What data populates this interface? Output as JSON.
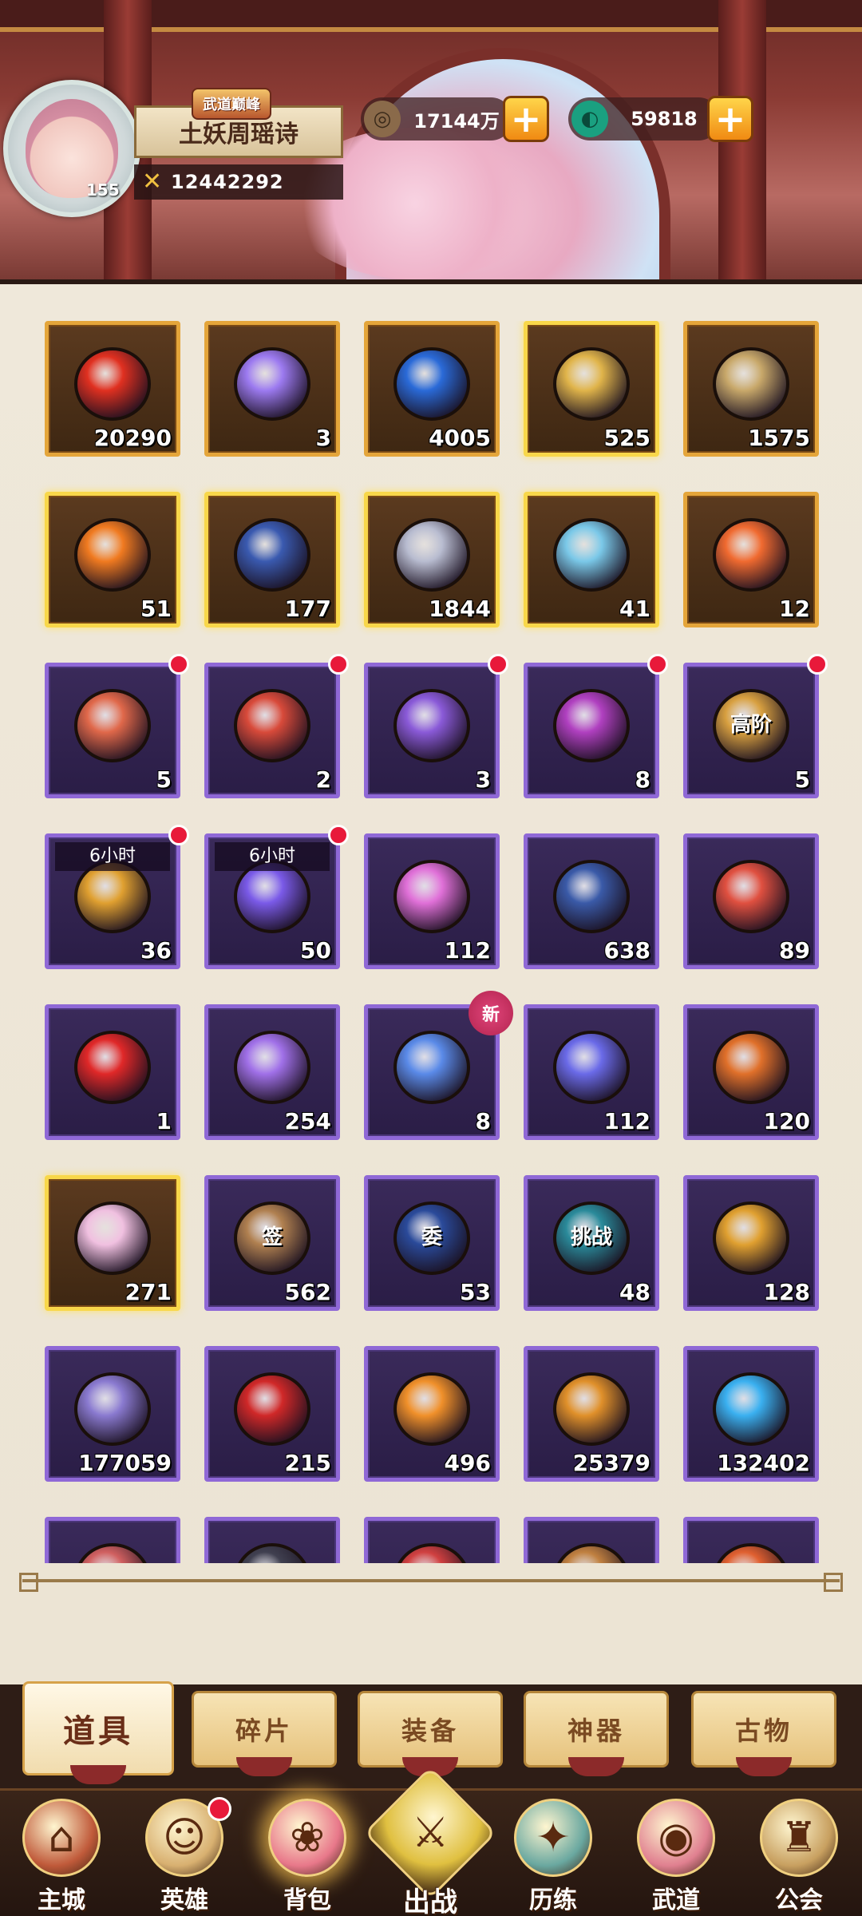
{
  "player": {
    "title_badge": "武道巅峰",
    "name": "土妖周瑶诗",
    "level": "155",
    "power": "12442292"
  },
  "resources": {
    "copper": "17144万",
    "jade": "59818"
  },
  "items": [
    {
      "qty": "20290",
      "frame": "gold",
      "icon": "red-orb-icon",
      "color": "#e03020"
    },
    {
      "qty": "3",
      "frame": "gold",
      "icon": "rainbow-crystal-icon",
      "color": "#9c7af0"
    },
    {
      "qty": "4005",
      "frame": "gold",
      "icon": "blue-powder-icon",
      "color": "#2a6ad8"
    },
    {
      "qty": "525",
      "frame": "gold glow",
      "icon": "gold-coin-icon",
      "color": "#e0b44a"
    },
    {
      "qty": "1575",
      "frame": "gold",
      "icon": "dagger-icon",
      "color": "#c8a86a"
    },
    {
      "qty": "51",
      "frame": "gold glow",
      "icon": "orange-swirl-icon",
      "color": "#f07a20"
    },
    {
      "qty": "177",
      "frame": "gold glow",
      "icon": "bagua-icon",
      "color": "#3a5ab0"
    },
    {
      "qty": "1844",
      "frame": "gold glow",
      "icon": "stone-block-icon",
      "color": "#b8bcd0"
    },
    {
      "qty": "41",
      "frame": "gold glow",
      "icon": "water-bottle-icon",
      "color": "#7ac8e8"
    },
    {
      "qty": "12",
      "frame": "gold",
      "icon": "fire-swirl-icon",
      "color": "#f06a30"
    },
    {
      "qty": "5",
      "frame": "purple",
      "icon": "treasure-chest-icon",
      "color": "#e0684a",
      "dot": true
    },
    {
      "qty": "2",
      "frame": "purple",
      "icon": "treasure-chest-icon",
      "color": "#d84a3a",
      "dot": true
    },
    {
      "qty": "3",
      "frame": "purple",
      "icon": "purple-chest-icon",
      "color": "#8a5ad8",
      "dot": true
    },
    {
      "qty": "8",
      "frame": "purple",
      "icon": "purple-box-icon",
      "color": "#b040c0",
      "dot": true
    },
    {
      "qty": "5",
      "frame": "purple",
      "icon": "gold-chest-icon",
      "color": "#d8a040",
      "dot": true,
      "label": "高阶"
    },
    {
      "qty": "36",
      "frame": "purple",
      "icon": "coin-bag-icon",
      "color": "#e0a030",
      "dot": true,
      "timer": "6小时"
    },
    {
      "qty": "50",
      "frame": "purple",
      "icon": "spirit-bag-icon",
      "color": "#7a5ae8",
      "dot": true,
      "timer": "6小时"
    },
    {
      "qty": "112",
      "frame": "purple",
      "icon": "pink-gem-icon",
      "color": "#e070d8"
    },
    {
      "qty": "638",
      "frame": "purple",
      "icon": "go-stones-icon",
      "color": "#3a5aa8"
    },
    {
      "qty": "89",
      "frame": "purple",
      "icon": "scroll-icon",
      "color": "#e05040"
    },
    {
      "qty": "1",
      "frame": "purple",
      "icon": "target-icon",
      "color": "#e02828"
    },
    {
      "qty": "254",
      "frame": "purple",
      "icon": "purple-medal-icon",
      "color": "#a070e8"
    },
    {
      "qty": "8",
      "frame": "purple",
      "icon": "blue-gem-icon",
      "color": "#5a8ae8",
      "new": "新"
    },
    {
      "qty": "112",
      "frame": "purple",
      "icon": "spirit-orb-icon",
      "color": "#6a6ae8"
    },
    {
      "qty": "120",
      "frame": "purple",
      "icon": "orange-disc-icon",
      "color": "#e0702a"
    },
    {
      "qty": "271",
      "frame": "gold glow",
      "icon": "rainbow-star-icon",
      "color": "#f0c0e0"
    },
    {
      "qty": "562",
      "frame": "purple",
      "icon": "sign-ticket-icon",
      "color": "#b08050",
      "label": "签"
    },
    {
      "qty": "53",
      "frame": "purple",
      "icon": "delegate-ticket-icon",
      "color": "#2a4a9a",
      "label": "委"
    },
    {
      "qty": "48",
      "frame": "purple",
      "icon": "challenge-ticket-icon",
      "color": "#2a8a9a",
      "label": "挑战"
    },
    {
      "qty": "128",
      "frame": "purple",
      "icon": "lion-token-icon",
      "color": "#e0a030"
    },
    {
      "qty": "177059",
      "frame": "purple",
      "icon": "soul-crystal-icon",
      "color": "#8a7ad0"
    },
    {
      "qty": "215",
      "frame": "purple",
      "icon": "red-swirl-icon",
      "color": "#d02828"
    },
    {
      "qty": "496",
      "frame": "purple",
      "icon": "flame-paw-icon",
      "color": "#f0902a"
    },
    {
      "qty": "25379",
      "frame": "purple",
      "icon": "paw-gem-icon",
      "color": "#e0902a"
    },
    {
      "qty": "132402",
      "frame": "purple",
      "icon": "ice-crystal-icon",
      "color": "#3ab0f0"
    },
    {
      "qty": "",
      "frame": "purple",
      "icon": "partial-item-icon",
      "color": "#d06060"
    },
    {
      "qty": "",
      "frame": "purple",
      "icon": "partial-item-icon",
      "color": "#404050"
    },
    {
      "qty": "",
      "frame": "purple",
      "icon": "partial-item-icon",
      "color": "#d04040"
    },
    {
      "qty": "",
      "frame": "purple",
      "icon": "partial-item-icon",
      "color": "#c08040"
    },
    {
      "qty": "",
      "frame": "purple",
      "icon": "partial-item-icon",
      "color": "#e06030"
    }
  ],
  "tabs": [
    {
      "label": "道具",
      "active": true
    },
    {
      "label": "碎片"
    },
    {
      "label": "装备"
    },
    {
      "label": "神器"
    },
    {
      "label": "古物"
    }
  ],
  "nav": [
    {
      "label": "主城",
      "icon": "castle-icon"
    },
    {
      "label": "英雄",
      "icon": "hero-icon",
      "dot": true
    },
    {
      "label": "背包",
      "icon": "bag-icon",
      "active": true
    },
    {
      "label": "出战",
      "icon": "battle-icon",
      "big": true
    },
    {
      "label": "历练",
      "icon": "training-icon"
    },
    {
      "label": "武道",
      "icon": "martial-icon"
    },
    {
      "label": "公会",
      "icon": "guild-icon"
    }
  ]
}
